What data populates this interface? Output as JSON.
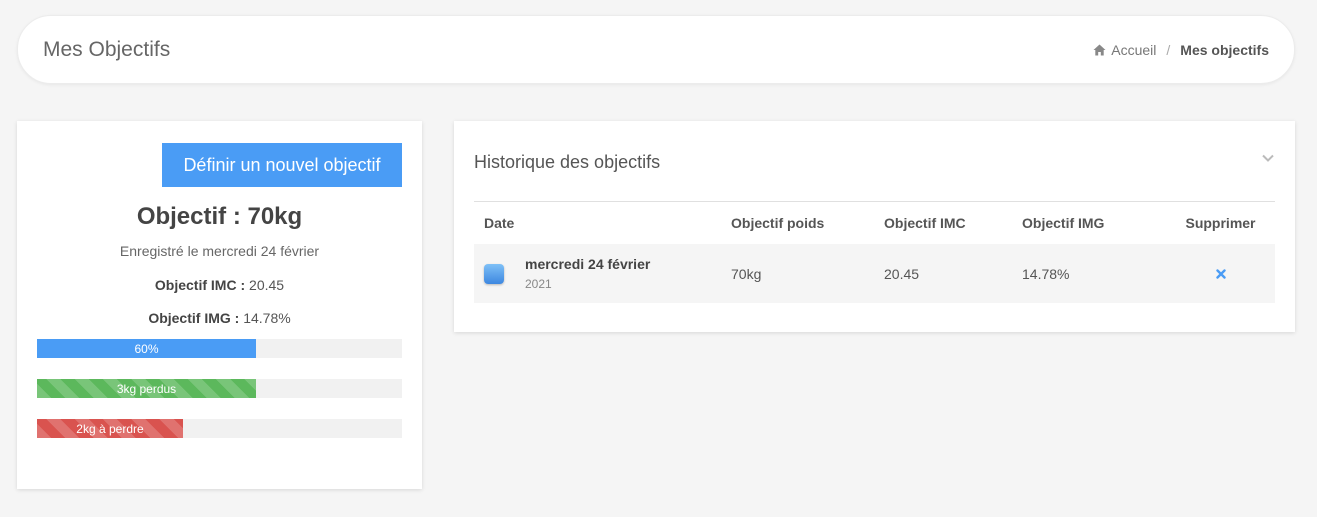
{
  "header": {
    "title": "Mes Objectifs",
    "breadcrumb": {
      "home": "Accueil",
      "separator": "/",
      "current": "Mes objectifs"
    }
  },
  "goal_card": {
    "new_goal_button": "Définir un nouvel objectif",
    "title": "Objectif : 70kg",
    "date_text": "Enregistré le mercredi 24 février",
    "imc_label": "Objectif IMC :",
    "imc_value": "20.45",
    "img_label": "Objectif IMG :",
    "img_value": "14.78%",
    "progress_bars": [
      {
        "label": "60%",
        "fraction": 0.6,
        "color": "#4a9cf5"
      },
      {
        "label": "3kg perdus",
        "fraction": 0.6,
        "color": "#5cb85c"
      },
      {
        "label": "2kg à perdre",
        "fraction": 0.4,
        "color": "#d9534f"
      }
    ]
  },
  "history": {
    "title": "Historique des objectifs",
    "columns": [
      "Date",
      "Objectif poids",
      "Objectif IMC",
      "Objectif IMG",
      "Supprimer"
    ],
    "rows": [
      {
        "date": "mercredi 24 février",
        "year": "2021",
        "weight": "70kg",
        "imc": "20.45",
        "img": "14.78%"
      }
    ]
  },
  "icons": {
    "home": "home-icon",
    "collapse": "chevron-down-icon",
    "delete": "close-icon",
    "row_marker": "calendar-dot-icon"
  }
}
